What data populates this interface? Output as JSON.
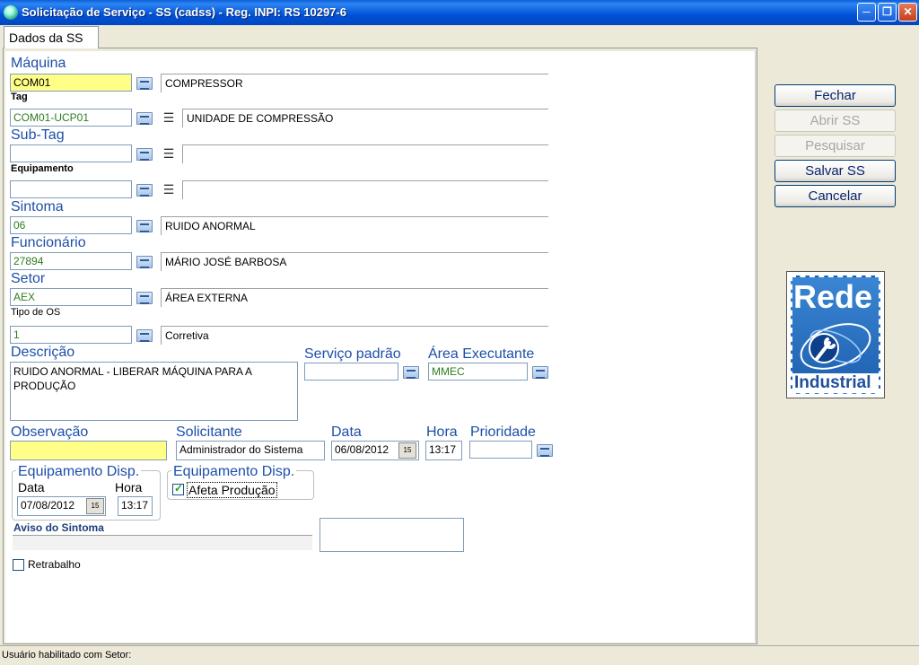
{
  "window": {
    "title": "Solicitação de Serviço - SS (cadss) - Reg. INPI: RS 10297-6",
    "minimize_icon": "minimize-icon",
    "restore_icon": "restore-icon",
    "close_icon": "close-icon"
  },
  "tab": {
    "label": "Dados da SS"
  },
  "form": {
    "maquina": {
      "label": "Máquina",
      "code": "COM01",
      "desc": "COMPRESSOR"
    },
    "tag": {
      "label": "Tag",
      "code": "COM01-UCP01",
      "desc": "UNIDADE DE COMPRESSÃO"
    },
    "subtag": {
      "label": "Sub-Tag",
      "code": "",
      "desc": ""
    },
    "equipamento": {
      "label": "Equipamento",
      "code": "",
      "desc": ""
    },
    "sintoma": {
      "label": "Sintoma",
      "code": "06",
      "desc": "RUIDO ANORMAL"
    },
    "funcionario": {
      "label": "Funcionário",
      "code": "27894",
      "desc": "MÁRIO JOSÉ BARBOSA"
    },
    "setor": {
      "label": "Setor",
      "code": "AEX",
      "desc": "ÁREA EXTERNA"
    },
    "tipo_os": {
      "label": "Tipo de OS",
      "code": "1",
      "desc": "Corretiva"
    },
    "descricao": {
      "label": "Descrição",
      "value": "RUIDO ANORMAL - LIBERAR MÁQUINA PARA A PRODUÇÃO"
    },
    "servico_padrao": {
      "label": "Serviço padrão",
      "value": ""
    },
    "area_executante": {
      "label": "Área Executante",
      "value": "MMEC"
    },
    "observacao": {
      "label": "Observação",
      "value": ""
    },
    "solicitante": {
      "label": "Solicitante",
      "value": "Administrador do Sistema"
    },
    "data": {
      "label": "Data",
      "value": "06/08/2012"
    },
    "hora": {
      "label": "Hora",
      "value": "13:17"
    },
    "prioridade": {
      "label": "Prioridade",
      "value": ""
    },
    "equip_disp_group": {
      "title": "Equipamento Disp.",
      "data_label": "Data",
      "data_value": "07/08/2012",
      "hora_label": "Hora",
      "hora_value": "13:17"
    },
    "equip_disp_group2": {
      "title": "Equipamento Disp.",
      "afeta_label": "Afeta Produção",
      "afeta_checked": true
    },
    "aviso_sintoma": {
      "label": "Aviso do Sintoma",
      "value": ""
    },
    "retrabalho": {
      "label": "Retrabalho",
      "checked": false
    },
    "calendar_icon_text": "15"
  },
  "buttons": {
    "fechar": "Fechar",
    "abrir_ss": "Abrir SS",
    "pesquisar": "Pesquisar",
    "salvar_ss": "Salvar SS",
    "cancelar": "Cancelar"
  },
  "logo": {
    "line1": "Rede",
    "line2": "Industrial"
  },
  "status": {
    "text": "Usuário habilitado com Setor:"
  },
  "colors": {
    "title_bar": "#0A5FD8",
    "label_blue": "#1C4FA8",
    "highlight_yellow": "#FFFF88"
  }
}
